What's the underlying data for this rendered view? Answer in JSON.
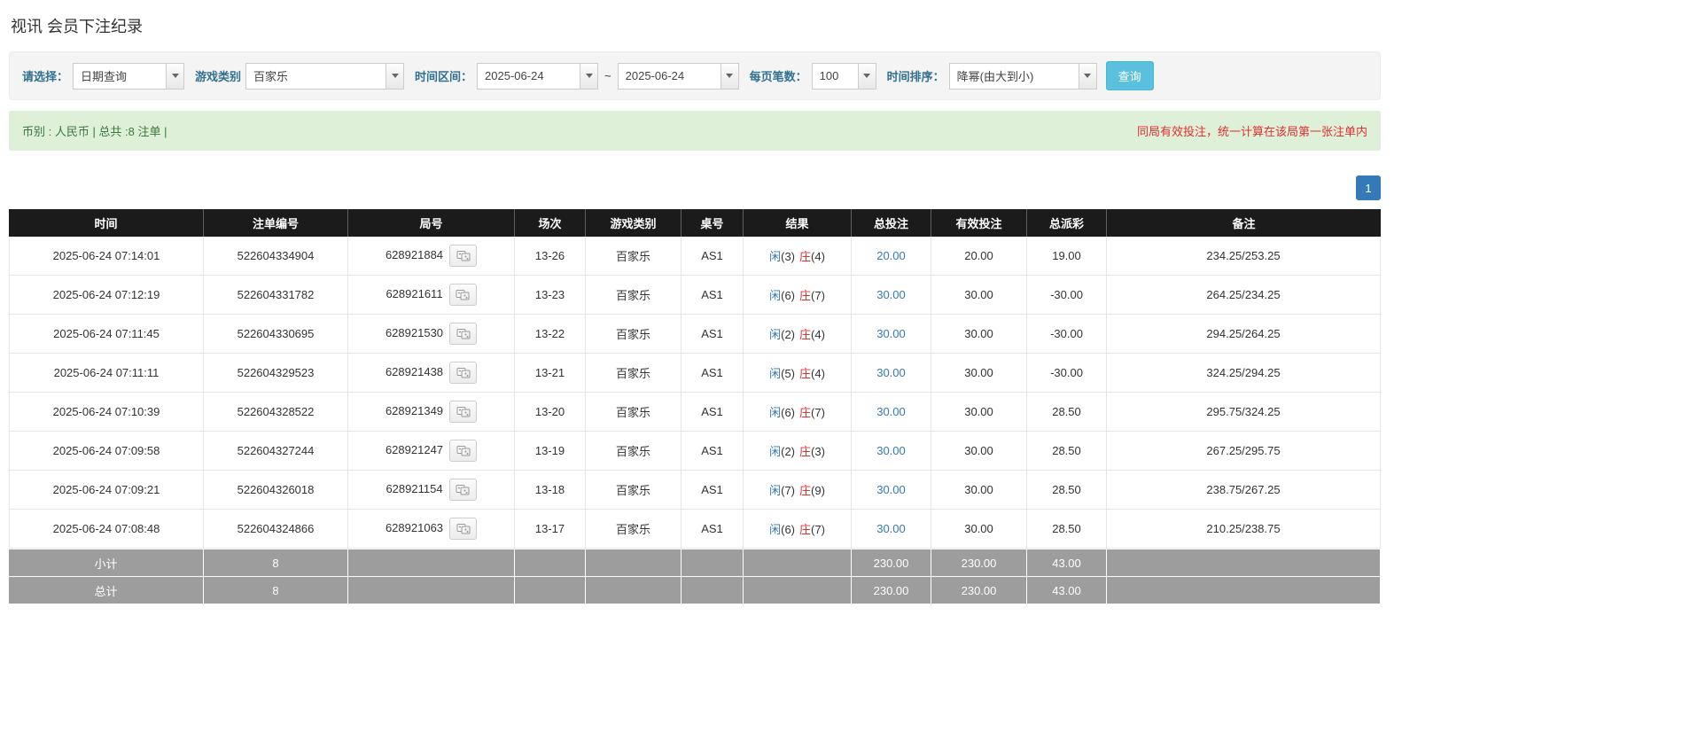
{
  "colors": {
    "accent_blue": "#337ab7",
    "danger_red": "#e13030",
    "table_header_bg": "#1b1b1b",
    "table_footer_bg": "#9d9d9d",
    "summary_bg": "#dff0d8",
    "summary_text": "#3c763d",
    "query_button_bg": "#5bc0de"
  },
  "page": {
    "title": "视讯 会员下注纪录"
  },
  "filters": {
    "select_label": "请选择：",
    "select_value": "日期查询",
    "game_label": "游戏类别",
    "game_value": "百家乐",
    "range_label": "时间区间：",
    "date_from": "2025-06-24",
    "range_separator": "~",
    "date_to": "2025-06-24",
    "page_size_label": "每页笔数：",
    "page_size_value": "100",
    "sort_label": "时间排序：",
    "sort_value": "降幂(由大到小)",
    "query_button": "查询"
  },
  "summary": {
    "left": "币别 : 人民币 | 总共 :8 注单 |",
    "right": "同局有效投注，统一计算在该局第一张注单内"
  },
  "pagination": {
    "page": "1"
  },
  "table": {
    "headers": [
      "时间",
      "注单编号",
      "局号",
      "场次",
      "游戏类别",
      "桌号",
      "结果",
      "总投注",
      "有效投注",
      "总派彩",
      "备注"
    ],
    "rows": [
      {
        "time": "2025-06-24 07:14:01",
        "bet_id": "522604334904",
        "round": "628921884",
        "session": "13-26",
        "game": "百家乐",
        "table_no": "AS1",
        "player": "闲",
        "player_pts": "(3)",
        "banker": "庄",
        "banker_pts": "(4)",
        "total_bet": "20.00",
        "valid_bet": "20.00",
        "payout": "19.00",
        "remark": "234.25/253.25"
      },
      {
        "time": "2025-06-24 07:12:19",
        "bet_id": "522604331782",
        "round": "628921611",
        "session": "13-23",
        "game": "百家乐",
        "table_no": "AS1",
        "player": "闲",
        "player_pts": "(6)",
        "banker": "庄",
        "banker_pts": "(7)",
        "total_bet": "30.00",
        "valid_bet": "30.00",
        "payout": "-30.00",
        "remark": "264.25/234.25"
      },
      {
        "time": "2025-06-24 07:11:45",
        "bet_id": "522604330695",
        "round": "628921530",
        "session": "13-22",
        "game": "百家乐",
        "table_no": "AS1",
        "player": "闲",
        "player_pts": "(2)",
        "banker": "庄",
        "banker_pts": "(4)",
        "total_bet": "30.00",
        "valid_bet": "30.00",
        "payout": "-30.00",
        "remark": "294.25/264.25"
      },
      {
        "time": "2025-06-24 07:11:11",
        "bet_id": "522604329523",
        "round": "628921438",
        "session": "13-21",
        "game": "百家乐",
        "table_no": "AS1",
        "player": "闲",
        "player_pts": "(5)",
        "banker": "庄",
        "banker_pts": "(4)",
        "total_bet": "30.00",
        "valid_bet": "30.00",
        "payout": "-30.00",
        "remark": "324.25/294.25"
      },
      {
        "time": "2025-06-24 07:10:39",
        "bet_id": "522604328522",
        "round": "628921349",
        "session": "13-20",
        "game": "百家乐",
        "table_no": "AS1",
        "player": "闲",
        "player_pts": "(6)",
        "banker": "庄",
        "banker_pts": "(7)",
        "total_bet": "30.00",
        "valid_bet": "30.00",
        "payout": "28.50",
        "remark": "295.75/324.25"
      },
      {
        "time": "2025-06-24 07:09:58",
        "bet_id": "522604327244",
        "round": "628921247",
        "session": "13-19",
        "game": "百家乐",
        "table_no": "AS1",
        "player": "闲",
        "player_pts": "(2)",
        "banker": "庄",
        "banker_pts": "(3)",
        "total_bet": "30.00",
        "valid_bet": "30.00",
        "payout": "28.50",
        "remark": "267.25/295.75"
      },
      {
        "time": "2025-06-24 07:09:21",
        "bet_id": "522604326018",
        "round": "628921154",
        "session": "13-18",
        "game": "百家乐",
        "table_no": "AS1",
        "player": "闲",
        "player_pts": "(7)",
        "banker": "庄",
        "banker_pts": "(9)",
        "total_bet": "30.00",
        "valid_bet": "30.00",
        "payout": "28.50",
        "remark": "238.75/267.25"
      },
      {
        "time": "2025-06-24 07:08:48",
        "bet_id": "522604324866",
        "round": "628921063",
        "session": "13-17",
        "game": "百家乐",
        "table_no": "AS1",
        "player": "闲",
        "player_pts": "(6)",
        "banker": "庄",
        "banker_pts": "(7)",
        "total_bet": "30.00",
        "valid_bet": "30.00",
        "payout": "28.50",
        "remark": "210.25/238.75"
      }
    ],
    "subtotal": {
      "label": "小计",
      "count": "8",
      "total_bet": "230.00",
      "valid_bet": "230.00",
      "payout": "43.00"
    },
    "total": {
      "label": "总计",
      "count": "8",
      "total_bet": "230.00",
      "valid_bet": "230.00",
      "payout": "43.00"
    }
  }
}
